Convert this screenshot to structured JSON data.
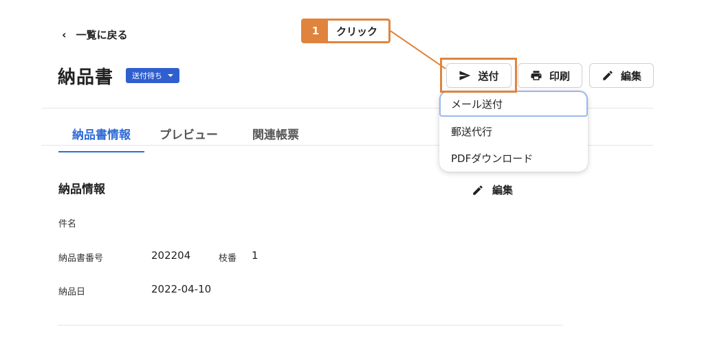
{
  "back_label": "一覧に戻る",
  "title": "納品書",
  "status_badge": "送付待ち",
  "buttons": {
    "send": "送付",
    "print": "印刷",
    "edit": "編集"
  },
  "tabs": [
    "納品書情報",
    "プレビュー",
    "関連帳票"
  ],
  "send_menu": [
    "メール送付",
    "郵送代行",
    "PDFダウンロード"
  ],
  "section": {
    "title": "納品情報",
    "edit": "編集"
  },
  "fields": {
    "subject_label": "件名",
    "number_label": "納品書番号",
    "number_value": "202204",
    "branch_label": "枝番",
    "branch_value": "1",
    "date_label": "納品日",
    "date_value": "2022-04-10"
  },
  "callout": {
    "step": "1",
    "text": "クリック"
  },
  "colors": {
    "accent": "#2f6bd6",
    "badge": "#2f5fcf",
    "callout": "#e0843d"
  }
}
